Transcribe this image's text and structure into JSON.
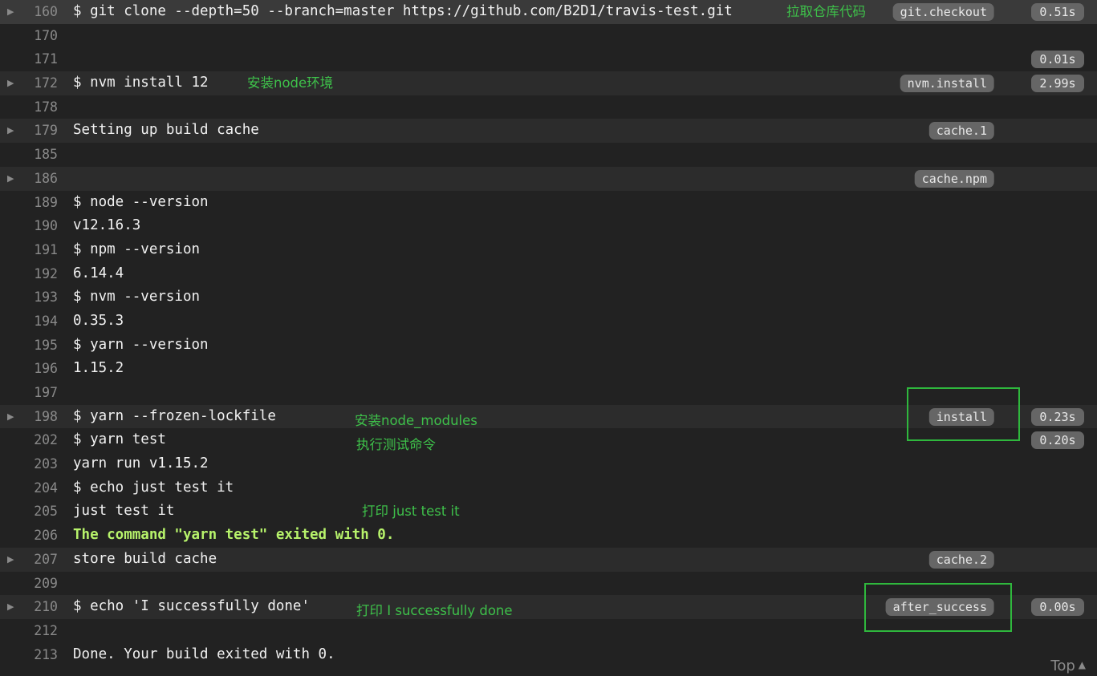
{
  "lines": [
    {
      "num": "160",
      "text": "$ git clone --depth=50 --branch=master https://github.com/B2D1/travis-test.git",
      "fold": true,
      "first": true,
      "tag": "git.checkout",
      "time": "0.51s",
      "annotation": "拉取仓库代码"
    },
    {
      "num": "170",
      "text": ""
    },
    {
      "num": "171",
      "text": "",
      "time": "0.01s"
    },
    {
      "num": "172",
      "text": "$ nvm install 12",
      "fold": true,
      "tag": "nvm.install",
      "time": "2.99s",
      "annotation": "安装node环境"
    },
    {
      "num": "178",
      "text": ""
    },
    {
      "num": "179",
      "text": "Setting up build cache",
      "fold": true,
      "tag": "cache.1"
    },
    {
      "num": "185",
      "text": ""
    },
    {
      "num": "186",
      "text": "",
      "fold": true,
      "tag": "cache.npm"
    },
    {
      "num": "189",
      "text": "$ node --version"
    },
    {
      "num": "190",
      "text": "v12.16.3"
    },
    {
      "num": "191",
      "text": "$ npm --version"
    },
    {
      "num": "192",
      "text": "6.14.4"
    },
    {
      "num": "193",
      "text": "$ nvm --version"
    },
    {
      "num": "194",
      "text": "0.35.3"
    },
    {
      "num": "195",
      "text": "$ yarn --version"
    },
    {
      "num": "196",
      "text": "1.15.2"
    },
    {
      "num": "197",
      "text": ""
    },
    {
      "num": "198",
      "text": "$ yarn --frozen-lockfile",
      "fold": true,
      "tag": "install",
      "time": "0.23s",
      "annotation": "安装node_modules"
    },
    {
      "num": "202",
      "text": "$ yarn test",
      "time": "0.20s",
      "annotation": "执行测试命令"
    },
    {
      "num": "203",
      "text": "yarn run v1.15.2"
    },
    {
      "num": "204",
      "text": "$ echo just test it"
    },
    {
      "num": "205",
      "text": "just test it",
      "annotation": "打印 just test it"
    },
    {
      "num": "206",
      "text": "The command \"yarn test\" exited with 0.",
      "style": "green"
    },
    {
      "num": "207",
      "text": "store build cache",
      "fold": true,
      "tag": "cache.2"
    },
    {
      "num": "209",
      "text": ""
    },
    {
      "num": "210",
      "text": "$ echo 'I successfully done'",
      "fold": true,
      "tag": "after_success",
      "time": "0.00s",
      "annotation": "打印 I successfully done"
    },
    {
      "num": "212",
      "text": ""
    },
    {
      "num": "213",
      "text": "Done. Your build exited with 0."
    }
  ],
  "top_link": {
    "label": "Top",
    "icon": "caret-up-icon"
  },
  "highlight_boxes": [
    "install",
    "after_success"
  ],
  "colors": {
    "background": "#222222",
    "fold_row": "#2c2c2c",
    "annotation": "#3ec04a",
    "success_text": "#b7f36b",
    "highlight_box": "#2fb83d",
    "tag_bg": "#666666"
  }
}
